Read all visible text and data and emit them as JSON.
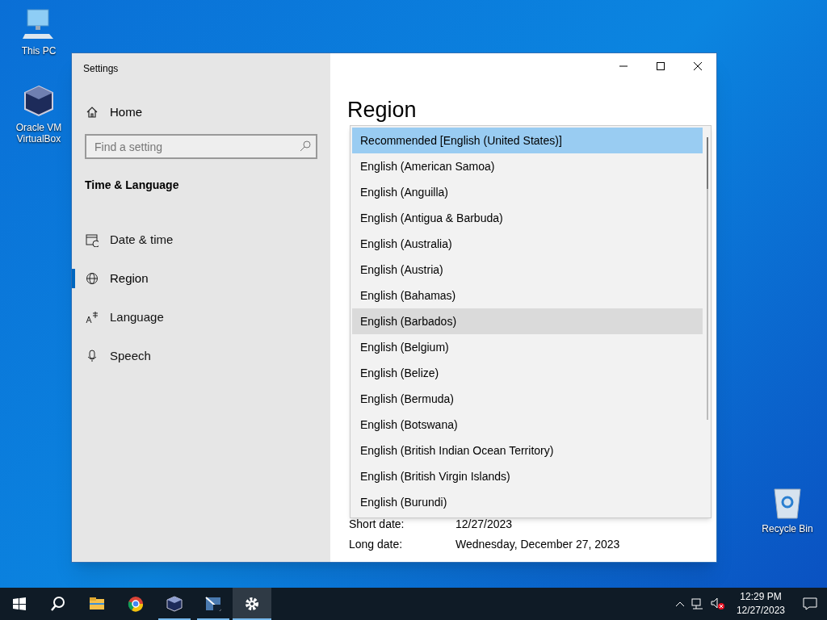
{
  "desktop_icons": [
    {
      "kind": "computer",
      "label": "This PC"
    },
    {
      "kind": "cube",
      "label": "Oracle VM VirtualBox"
    },
    {
      "kind": "bin",
      "label": "Recycle Bin"
    }
  ],
  "window": {
    "title": "Settings"
  },
  "sidebar": {
    "home": "Home",
    "search": {
      "placeholder": "Find a setting"
    },
    "section": "Time & Language",
    "items": [
      {
        "kind": "calendar",
        "label": "Date & time",
        "selected": false
      },
      {
        "kind": "globe",
        "label": "Region",
        "selected": true
      },
      {
        "kind": "language",
        "label": "Language",
        "selected": false
      },
      {
        "kind": "mic",
        "label": "Speech",
        "selected": false
      }
    ]
  },
  "page": {
    "title": "Region",
    "dropdown": [
      {
        "label": "Recommended [English (United States)]",
        "selected": true,
        "hovered": false
      },
      {
        "label": "English (American Samoa)",
        "selected": false,
        "hovered": false
      },
      {
        "label": "English (Anguilla)",
        "selected": false,
        "hovered": false
      },
      {
        "label": "English (Antigua & Barbuda)",
        "selected": false,
        "hovered": false
      },
      {
        "label": "English (Australia)",
        "selected": false,
        "hovered": false
      },
      {
        "label": "English (Austria)",
        "selected": false,
        "hovered": false
      },
      {
        "label": "English (Bahamas)",
        "selected": false,
        "hovered": false
      },
      {
        "label": "English (Barbados)",
        "selected": false,
        "hovered": true
      },
      {
        "label": "English (Belgium)",
        "selected": false,
        "hovered": false
      },
      {
        "label": "English (Belize)",
        "selected": false,
        "hovered": false
      },
      {
        "label": "English (Bermuda)",
        "selected": false,
        "hovered": false
      },
      {
        "label": "English (Botswana)",
        "selected": false,
        "hovered": false
      },
      {
        "label": "English (British Indian Ocean Territory)",
        "selected": false,
        "hovered": false
      },
      {
        "label": "English (British Virgin Islands)",
        "selected": false,
        "hovered": false
      },
      {
        "label": "English (Burundi)",
        "selected": false,
        "hovered": false
      }
    ],
    "formats": [
      {
        "label": "Short date:",
        "value": "12/27/2023"
      },
      {
        "label": "Long date:",
        "value": "Wednesday, December 27, 2023"
      }
    ]
  },
  "taskbar": {
    "apps": [
      {
        "kind": "start",
        "running": false,
        "selected": false
      },
      {
        "kind": "search",
        "running": false,
        "selected": false
      },
      {
        "kind": "folder",
        "running": false,
        "selected": false
      },
      {
        "kind": "browser",
        "running": false,
        "selected": false
      },
      {
        "kind": "cube",
        "running": true,
        "selected": false
      },
      {
        "kind": "xp",
        "running": true,
        "selected": false
      },
      {
        "kind": "gear",
        "running": true,
        "selected": true
      }
    ],
    "time": "12:29 PM",
    "date": "12/27/2023"
  }
}
